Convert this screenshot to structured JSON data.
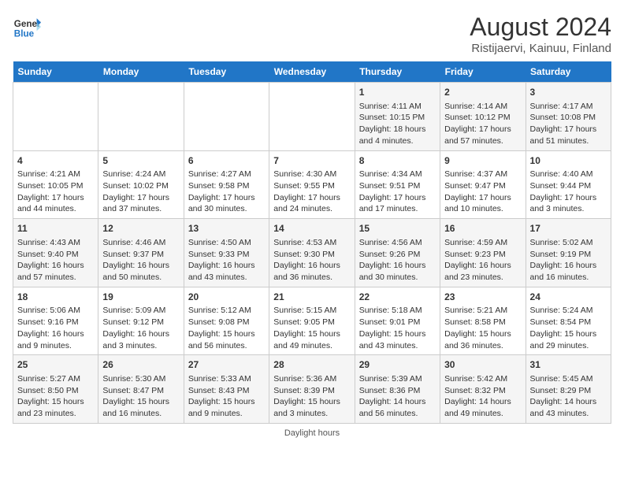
{
  "header": {
    "logo_line1": "General",
    "logo_line2": "Blue",
    "title": "August 2024",
    "subtitle": "Ristijaervi, Kainuu, Finland"
  },
  "days_of_week": [
    "Sunday",
    "Monday",
    "Tuesday",
    "Wednesday",
    "Thursday",
    "Friday",
    "Saturday"
  ],
  "weeks": [
    [
      {
        "day": "",
        "info": ""
      },
      {
        "day": "",
        "info": ""
      },
      {
        "day": "",
        "info": ""
      },
      {
        "day": "",
        "info": ""
      },
      {
        "day": "1",
        "info": "Sunrise: 4:11 AM\nSunset: 10:15 PM\nDaylight: 18 hours and 4 minutes."
      },
      {
        "day": "2",
        "info": "Sunrise: 4:14 AM\nSunset: 10:12 PM\nDaylight: 17 hours and 57 minutes."
      },
      {
        "day": "3",
        "info": "Sunrise: 4:17 AM\nSunset: 10:08 PM\nDaylight: 17 hours and 51 minutes."
      }
    ],
    [
      {
        "day": "4",
        "info": "Sunrise: 4:21 AM\nSunset: 10:05 PM\nDaylight: 17 hours and 44 minutes."
      },
      {
        "day": "5",
        "info": "Sunrise: 4:24 AM\nSunset: 10:02 PM\nDaylight: 17 hours and 37 minutes."
      },
      {
        "day": "6",
        "info": "Sunrise: 4:27 AM\nSunset: 9:58 PM\nDaylight: 17 hours and 30 minutes."
      },
      {
        "day": "7",
        "info": "Sunrise: 4:30 AM\nSunset: 9:55 PM\nDaylight: 17 hours and 24 minutes."
      },
      {
        "day": "8",
        "info": "Sunrise: 4:34 AM\nSunset: 9:51 PM\nDaylight: 17 hours and 17 minutes."
      },
      {
        "day": "9",
        "info": "Sunrise: 4:37 AM\nSunset: 9:47 PM\nDaylight: 17 hours and 10 minutes."
      },
      {
        "day": "10",
        "info": "Sunrise: 4:40 AM\nSunset: 9:44 PM\nDaylight: 17 hours and 3 minutes."
      }
    ],
    [
      {
        "day": "11",
        "info": "Sunrise: 4:43 AM\nSunset: 9:40 PM\nDaylight: 16 hours and 57 minutes."
      },
      {
        "day": "12",
        "info": "Sunrise: 4:46 AM\nSunset: 9:37 PM\nDaylight: 16 hours and 50 minutes."
      },
      {
        "day": "13",
        "info": "Sunrise: 4:50 AM\nSunset: 9:33 PM\nDaylight: 16 hours and 43 minutes."
      },
      {
        "day": "14",
        "info": "Sunrise: 4:53 AM\nSunset: 9:30 PM\nDaylight: 16 hours and 36 minutes."
      },
      {
        "day": "15",
        "info": "Sunrise: 4:56 AM\nSunset: 9:26 PM\nDaylight: 16 hours and 30 minutes."
      },
      {
        "day": "16",
        "info": "Sunrise: 4:59 AM\nSunset: 9:23 PM\nDaylight: 16 hours and 23 minutes."
      },
      {
        "day": "17",
        "info": "Sunrise: 5:02 AM\nSunset: 9:19 PM\nDaylight: 16 hours and 16 minutes."
      }
    ],
    [
      {
        "day": "18",
        "info": "Sunrise: 5:06 AM\nSunset: 9:16 PM\nDaylight: 16 hours and 9 minutes."
      },
      {
        "day": "19",
        "info": "Sunrise: 5:09 AM\nSunset: 9:12 PM\nDaylight: 16 hours and 3 minutes."
      },
      {
        "day": "20",
        "info": "Sunrise: 5:12 AM\nSunset: 9:08 PM\nDaylight: 15 hours and 56 minutes."
      },
      {
        "day": "21",
        "info": "Sunrise: 5:15 AM\nSunset: 9:05 PM\nDaylight: 15 hours and 49 minutes."
      },
      {
        "day": "22",
        "info": "Sunrise: 5:18 AM\nSunset: 9:01 PM\nDaylight: 15 hours and 43 minutes."
      },
      {
        "day": "23",
        "info": "Sunrise: 5:21 AM\nSunset: 8:58 PM\nDaylight: 15 hours and 36 minutes."
      },
      {
        "day": "24",
        "info": "Sunrise: 5:24 AM\nSunset: 8:54 PM\nDaylight: 15 hours and 29 minutes."
      }
    ],
    [
      {
        "day": "25",
        "info": "Sunrise: 5:27 AM\nSunset: 8:50 PM\nDaylight: 15 hours and 23 minutes."
      },
      {
        "day": "26",
        "info": "Sunrise: 5:30 AM\nSunset: 8:47 PM\nDaylight: 15 hours and 16 minutes."
      },
      {
        "day": "27",
        "info": "Sunrise: 5:33 AM\nSunset: 8:43 PM\nDaylight: 15 hours and 9 minutes."
      },
      {
        "day": "28",
        "info": "Sunrise: 5:36 AM\nSunset: 8:39 PM\nDaylight: 15 hours and 3 minutes."
      },
      {
        "day": "29",
        "info": "Sunrise: 5:39 AM\nSunset: 8:36 PM\nDaylight: 14 hours and 56 minutes."
      },
      {
        "day": "30",
        "info": "Sunrise: 5:42 AM\nSunset: 8:32 PM\nDaylight: 14 hours and 49 minutes."
      },
      {
        "day": "31",
        "info": "Sunrise: 5:45 AM\nSunset: 8:29 PM\nDaylight: 14 hours and 43 minutes."
      }
    ]
  ],
  "footer": "Daylight hours"
}
